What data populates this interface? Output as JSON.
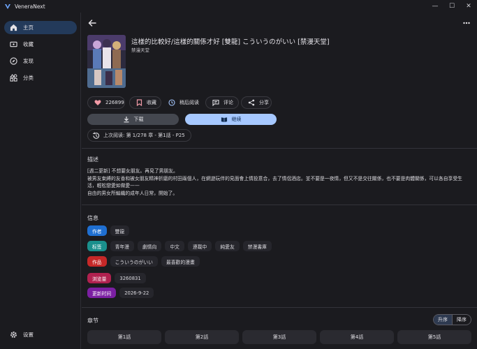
{
  "app": {
    "title": "VeneraNext"
  },
  "window_controls": {
    "minimize": "—",
    "maximize": "☐",
    "close": "✕"
  },
  "sidebar": {
    "items": [
      {
        "label": "主页",
        "icon": "home-icon",
        "active": true
      },
      {
        "label": "收藏",
        "icon": "ticket-icon",
        "active": false
      },
      {
        "label": "发现",
        "icon": "explore-icon",
        "active": false
      },
      {
        "label": "分类",
        "icon": "category-icon",
        "active": false
      }
    ],
    "settings": {
      "label": "设置",
      "icon": "gear-icon"
    }
  },
  "comic": {
    "title": "這樣的比較好/這樣的關係才好 [雙龍] こういうのがいい [禁漫天堂]",
    "source": "禁漫天堂"
  },
  "actions": {
    "likes": "226899",
    "favorite": "收藏",
    "read_later": "稍后阅读",
    "comment": "评论",
    "share": "分享"
  },
  "buttons": {
    "download": "下载",
    "continue": "继续"
  },
  "last_read": "上次阅读: 第 1/278 章 - 第1話 - P25",
  "description": {
    "heading": "描述",
    "text": "[週二更新] 不想要女朋友。再見了男朋友。\n被男友束縛的友香和被女朋友精神折磨的村田兩個人，在網遊玩伴的見面會上情投意合，去了情侶酒店。並不要是一夜情，但又不是交往關係，也不要是肉體關係，可以各自享受生活，輕松戀愛如做愛——\n自由的男女所編織的成年人日常，開始了。"
  },
  "info": {
    "heading": "信息",
    "rows": [
      {
        "key": "作者",
        "color": "#1f6fd1",
        "values": [
          "雙龍"
        ]
      },
      {
        "key": "标签",
        "color": "#1a8f8c",
        "values": [
          "青年漫",
          "劇情向",
          "中文",
          "連載中",
          "純愛友",
          "禁漫書庫"
        ]
      },
      {
        "key": "作品",
        "color": "#c62828",
        "values": [
          "こういうのがいい",
          "最喜歡的漫畫"
        ]
      },
      {
        "key": "浏览量",
        "color": "#b0214f",
        "values": [
          "3260831"
        ]
      },
      {
        "key": "更新时间",
        "color": "#7b1fa2",
        "values": [
          "2026-9-22"
        ]
      }
    ]
  },
  "chapters": {
    "heading": "章节",
    "sort_asc": "升序",
    "sort_desc": "降序",
    "items": [
      "第1話",
      "第2話",
      "第3話",
      "第4話",
      "第5話"
    ]
  },
  "colors": {
    "accent": "#a6c8ff",
    "sidebar_active": "#233a5a",
    "background": "#1b1b1f"
  }
}
